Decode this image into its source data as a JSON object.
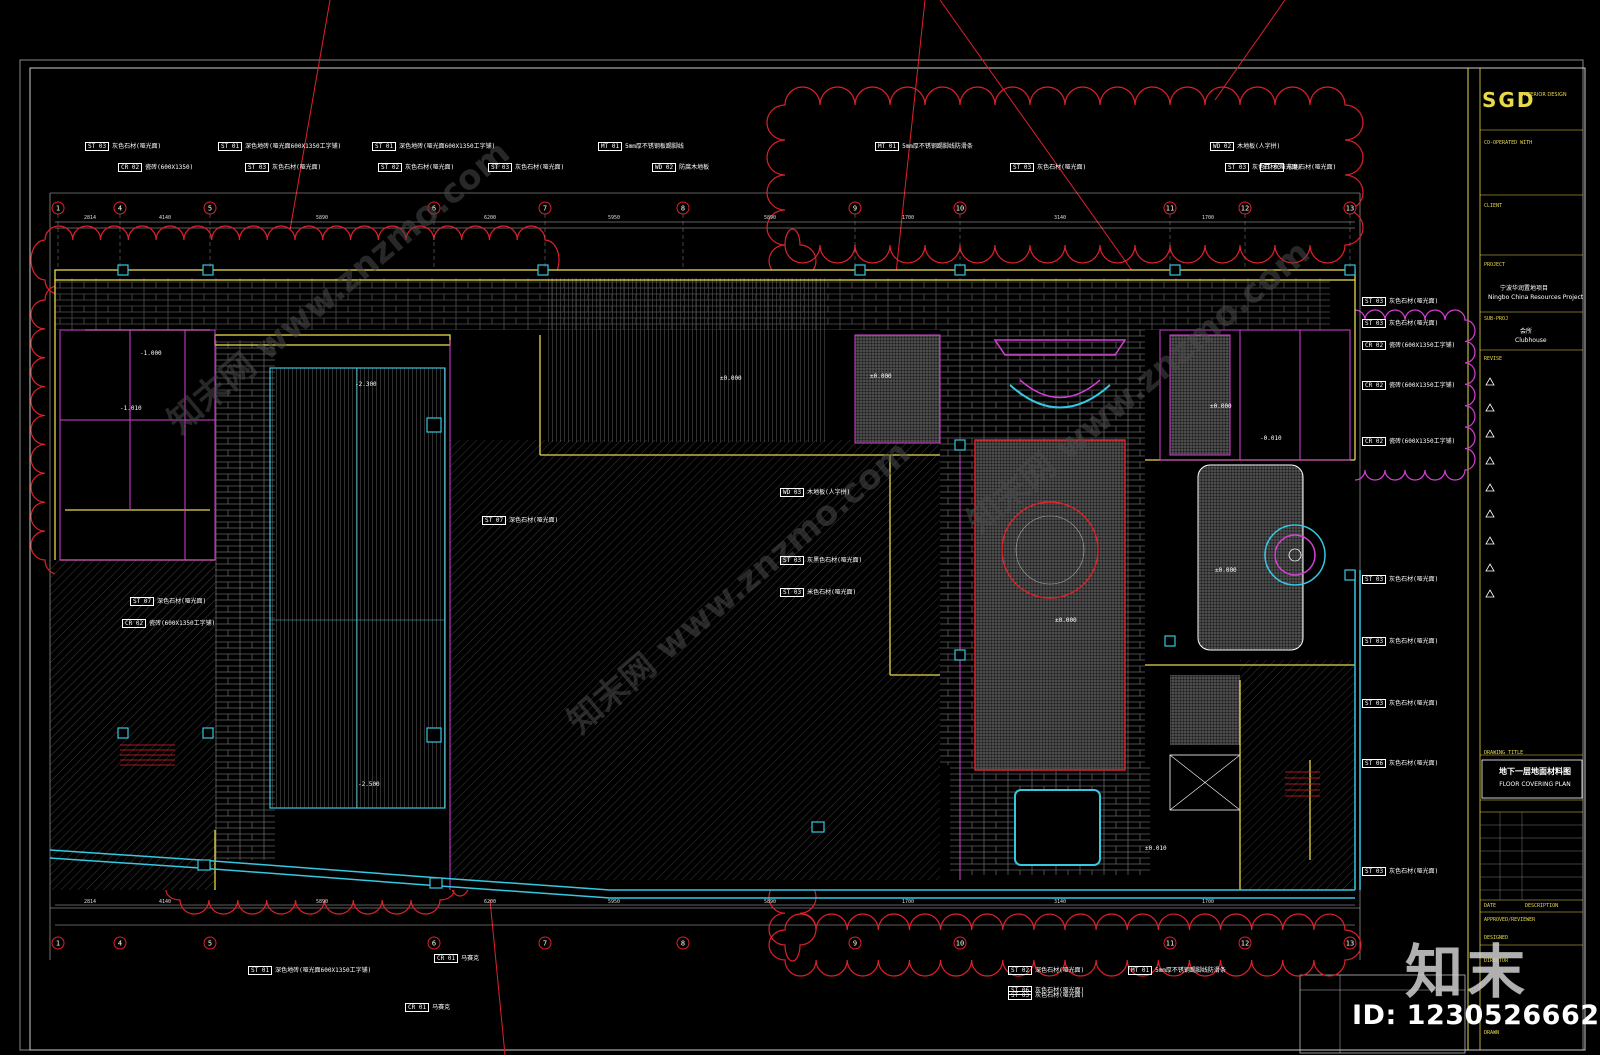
{
  "title_block": {
    "brand": "SGD",
    "brand_sub": "INTERIOR DESIGN",
    "project_cn": "宁波华润置地项目",
    "project_en": "Ningbo China Resources Project",
    "area_cn": "会所",
    "area_en": "Clubhouse",
    "drawing_title_cn": "地下一层地面材料图",
    "drawing_title_en": "FLOOR COVERING PLAN",
    "labels": [
      "CO-OPERATED WITH",
      "CLIENT",
      "PROJECT",
      "SUB-PROJ",
      "REVISE",
      "DRAWING TITLE",
      "DATE",
      "DESCRIPTION",
      "APPROVED/REVIEWER",
      "DESIGNED",
      "DIRECTOR",
      "DRAWN"
    ]
  },
  "watermark": {
    "logo": "知末",
    "id": "ID: 1230526662",
    "site": "知末网 www.znzmo.com"
  },
  "grid": {
    "axes": [
      "1",
      "4",
      "5",
      "6",
      "7",
      "8",
      "9",
      "10",
      "11",
      "12",
      "13"
    ],
    "dims_top": [
      "2814",
      "4140",
      "5890",
      "6200",
      "5950",
      "5890",
      "1700",
      "3140",
      "1700"
    ]
  },
  "callouts_top": [
    {
      "code": "ST 03",
      "text": "灰色石材(哑光面)"
    },
    {
      "code": "CR 02",
      "text": "瓷砖(600X1350)"
    },
    {
      "code": "ST 01",
      "text": "深色地砖(哑光面600X1350工字铺)"
    },
    {
      "code": "ST 03",
      "text": "灰色石材(哑光面)"
    },
    {
      "code": "ST 01",
      "text": "深色地砖(哑光面600X1350工字铺)"
    },
    {
      "code": "ST 02",
      "text": "灰色石材(哑光面)"
    },
    {
      "code": "ST 03",
      "text": "灰色石材(哑光面)"
    },
    {
      "code": "MT 01",
      "text": "5mm厚不锈钢板踢脚线"
    },
    {
      "code": "WD 02",
      "text": "防腐木地板"
    },
    {
      "code": "MT 01",
      "text": "5mm厚不锈钢踢脚线防滑条"
    },
    {
      "code": "ST 03",
      "text": "灰色石材(哑光面)"
    },
    {
      "code": "ST 03",
      "text": "灰色石材(哑光面)"
    },
    {
      "code": "WD 02",
      "text": "木地板(人字拼)"
    },
    {
      "code": "ST 03",
      "text": "灰色石材(哑光面)"
    }
  ],
  "callouts_right": [
    {
      "code": "ST 03",
      "text": "灰色石材(哑光面)"
    },
    {
      "code": "ST 03",
      "text": "灰色石材(哑光面)"
    },
    {
      "code": "CR 02",
      "text": "瓷砖(600X1350工字铺)"
    },
    {
      "code": "CR 02",
      "text": "瓷砖(600X1350工字铺)"
    },
    {
      "code": "CR 02",
      "text": "瓷砖(600X1350工字铺)"
    },
    {
      "code": "ST 03",
      "text": "灰色石材(哑光面)"
    },
    {
      "code": "ST 03",
      "text": "灰色石材(哑光面)"
    },
    {
      "code": "ST 03",
      "text": "灰色石材(哑光面)"
    },
    {
      "code": "ST 06",
      "text": "灰色石材(哑光面)"
    },
    {
      "code": "ST 03",
      "text": "灰色石材(哑光面)"
    }
  ],
  "callouts_mid": [
    {
      "code": "ST 07",
      "text": "深色石材(哑光面)"
    },
    {
      "code": "WD 03",
      "text": "木地板(人字拼)"
    },
    {
      "code": "ST 03",
      "text": "灰黑色石材(哑光面)"
    },
    {
      "code": "ST 03",
      "text": "米色石材(哑光面)"
    }
  ],
  "callouts_bottom": [
    {
      "code": "ST 01",
      "text": "深色地砖(哑光面600X1350工字铺)"
    },
    {
      "code": "CR 01",
      "text": "马赛克"
    },
    {
      "code": "CR 01",
      "text": "马赛克"
    },
    {
      "code": "ST 02",
      "text": "深色石材(哑光面)"
    },
    {
      "code": "ST 03",
      "text": "灰色石材(哑光面)"
    },
    {
      "code": "ST 06",
      "text": "灰色石材(哑光面)"
    },
    {
      "code": "MT 01",
      "text": "5mm厚不锈钢踢脚线防滑条"
    }
  ],
  "callouts_left": [
    {
      "code": "ST 07",
      "text": "深色石材(哑光面)"
    },
    {
      "code": "CR 02",
      "text": "瓷砖(600X1350工字铺)"
    }
  ],
  "levels": [
    "±0.000",
    "-2.300",
    "-2.500",
    "±0.000",
    "±0.000",
    "±0.000",
    "±0.000",
    "-1.000",
    "-1.010",
    "-0.010",
    "±0.010"
  ],
  "colors": {
    "background": "#000000",
    "frame": "#e8d84a",
    "wall": "#e8d84a",
    "cloud": "#e0202a",
    "magenta": "#d63fd6",
    "cyan": "#35c8e0",
    "grid_axis": "#e0202a",
    "hatch": "#8a8a8a"
  }
}
